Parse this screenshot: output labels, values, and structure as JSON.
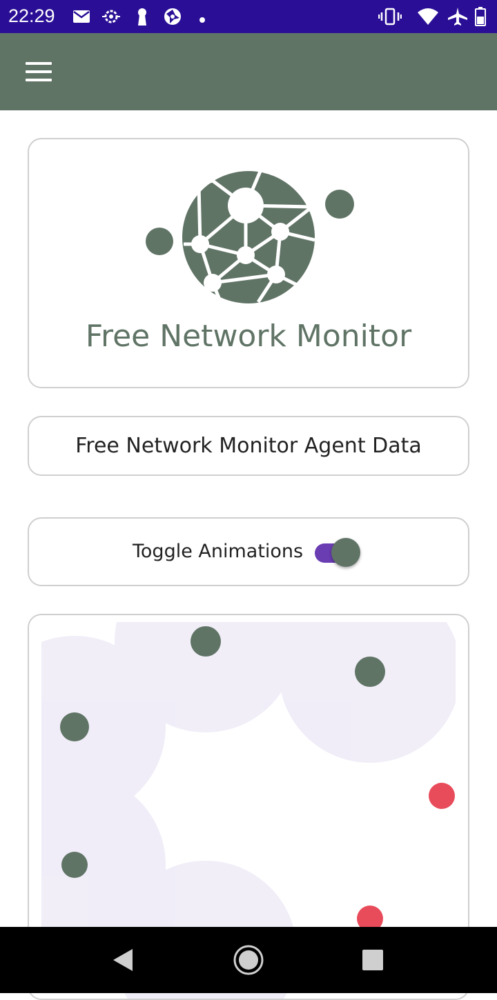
{
  "status_bar": {
    "time": "22:29",
    "left_icons": [
      "mail-icon",
      "sync-gear-icon",
      "keyhole-icon",
      "aperture-icon",
      "dot-icon"
    ],
    "right_icons": [
      "vibrate-icon",
      "wifi-icon",
      "airplane-icon",
      "battery-icon"
    ]
  },
  "app_bar": {
    "menu_icon": "hamburger-menu-icon"
  },
  "logo_card": {
    "title": "Free Network Monitor",
    "logo_icon": "network-globe-icon"
  },
  "agent_card": {
    "label": "Free Network Monitor Agent Data"
  },
  "toggle_card": {
    "label": "Toggle Animations",
    "enabled": true
  },
  "animation": {
    "nodes": [
      {
        "status": "up"
      },
      {
        "status": "up"
      },
      {
        "status": "up"
      },
      {
        "status": "up"
      },
      {
        "status": "down"
      },
      {
        "status": "down"
      }
    ]
  },
  "colors": {
    "status_bar": "#2a0f96",
    "accent": "#607466",
    "toggle_track": "#6a3db3",
    "node_up": "#607466",
    "node_down": "#e84b5a",
    "pulse": "#ece8f6"
  },
  "nav_bar": {
    "buttons": [
      "back-icon",
      "home-icon",
      "recents-icon"
    ]
  }
}
